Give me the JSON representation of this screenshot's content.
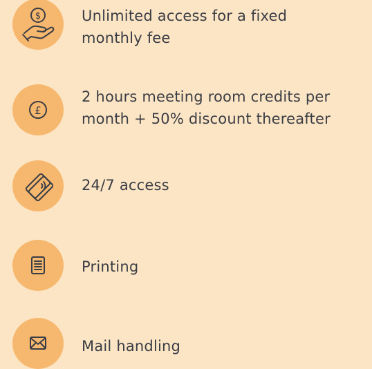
{
  "features": [
    {
      "icon": "hand-dollar-coin-icon",
      "label": "Unlimited access for a fixed\nmonthly fee"
    },
    {
      "icon": "pound-coin-icon",
      "label": "2 hours meeting room credits per\nmonth + 50% discount thereafter"
    },
    {
      "icon": "access-card-icon",
      "label": "24/7 access"
    },
    {
      "icon": "document-icon",
      "label": "Printing"
    },
    {
      "icon": "envelope-icon",
      "label": "Mail handling"
    }
  ],
  "colors": {
    "background": "#fce5c4",
    "icon_circle": "#f6b86e",
    "icon_stroke": "#3a3d45",
    "text": "#3a3d45"
  }
}
